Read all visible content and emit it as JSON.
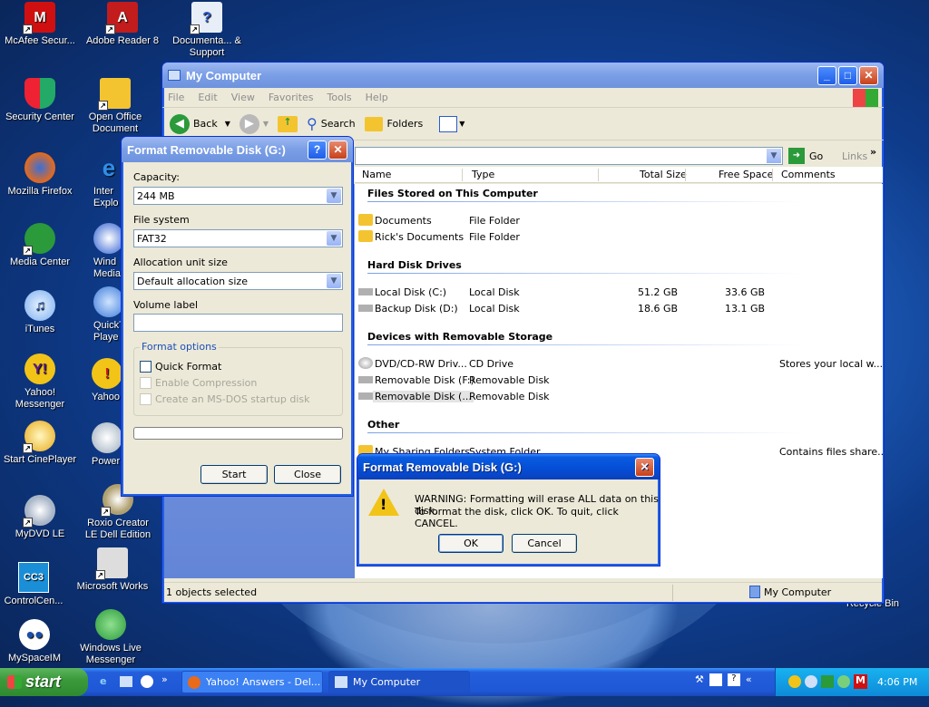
{
  "desktop_icons": [
    {
      "label": "McAfee Secur...",
      "icon": "mcafee-icon"
    },
    {
      "label": "Adobe Reader 8",
      "icon": "adobe-reader-icon"
    },
    {
      "label": "Documenta... & Support",
      "icon": "help-document-icon"
    },
    {
      "label": "Security Center",
      "icon": "shield-icon"
    },
    {
      "label": "Open Office Document",
      "icon": "open-office-icon"
    },
    {
      "label": "Mozilla Firefox",
      "icon": "firefox-icon"
    },
    {
      "label": "Inter Explo",
      "icon": "internet-explorer-icon"
    },
    {
      "label": "Media Center",
      "icon": "media-center-icon"
    },
    {
      "label": "Wind Media",
      "icon": "media-player-icon"
    },
    {
      "label": "iTunes",
      "icon": "itunes-icon"
    },
    {
      "label": "QuickT Playe",
      "icon": "quicktime-icon"
    },
    {
      "label": "Yahoo! Messenger",
      "icon": "yahoo-messenger-icon"
    },
    {
      "label": "Yahoo",
      "icon": "yahoo-icon"
    },
    {
      "label": "Start CinePlayer",
      "icon": "cineplayer-icon"
    },
    {
      "label": "PowerD",
      "icon": "powerdvd-icon"
    },
    {
      "label": "MyDVD LE",
      "icon": "mydvd-icon"
    },
    {
      "label": "Roxio Creator LE Dell Edition",
      "icon": "roxio-icon"
    },
    {
      "label": "ControlCen...",
      "icon": "controlcenter-icon"
    },
    {
      "label": "Microsoft Works",
      "icon": "works-icon"
    },
    {
      "label": "MySpaceIM",
      "icon": "myspace-icon"
    },
    {
      "label": "Windows Live Messenger",
      "icon": "live-messenger-icon"
    },
    {
      "label": "Recycle Bin",
      "icon": "recycle-bin-icon"
    }
  ],
  "mycomputer": {
    "title": "My Computer",
    "menu": [
      "File",
      "Edit",
      "View",
      "Favorites",
      "Tools",
      "Help"
    ],
    "toolbar": {
      "back": "Back",
      "search": "Search",
      "folders": "Folders"
    },
    "address": {
      "go": "Go",
      "links": "Links"
    },
    "columns": [
      "Name",
      "Type",
      "Total Size",
      "Free Space",
      "Comments"
    ],
    "groups": {
      "stored": "Files Stored on This Computer",
      "hdd": "Hard Disk Drives",
      "removable": "Devices with Removable Storage",
      "other": "Other"
    },
    "rows": [
      {
        "name": "Documents",
        "type": "File Folder",
        "total": "",
        "free": "",
        "comments": ""
      },
      {
        "name": "Rick's Documents",
        "type": "File Folder",
        "total": "",
        "free": "",
        "comments": ""
      },
      {
        "name": "Local Disk (C:)",
        "type": "Local Disk",
        "total": "51.2 GB",
        "free": "33.6 GB",
        "comments": ""
      },
      {
        "name": "Backup Disk (D:)",
        "type": "Local Disk",
        "total": "18.6 GB",
        "free": "13.1 GB",
        "comments": ""
      },
      {
        "name": "DVD/CD-RW Driv...",
        "type": "CD Drive",
        "total": "",
        "free": "",
        "comments": "Stores your local w..."
      },
      {
        "name": "Removable Disk (F:)",
        "type": "Removable Disk",
        "total": "",
        "free": "",
        "comments": ""
      },
      {
        "name": "Removable Disk (...",
        "type": "Removable Disk",
        "total": "",
        "free": "",
        "comments": ""
      },
      {
        "name": "My Sharing Folders",
        "type": "System Folder",
        "total": "",
        "free": "",
        "comments": "Contains files share..."
      }
    ],
    "status_left": "1 objects selected",
    "status_right": "My Computer"
  },
  "format_dialog": {
    "title": "Format Removable Disk (G:)",
    "capacity_label": "Capacity:",
    "capacity_value": "244 MB",
    "fs_label": "File system",
    "fs_value": "FAT32",
    "alloc_label": "Allocation unit size",
    "alloc_value": "Default allocation size",
    "volume_label": "Volume label",
    "volume_value": "",
    "options_label": "Format options",
    "quick_format": "Quick Format",
    "compression": "Enable Compression",
    "msdos": "Create an MS-DOS startup disk",
    "start": "Start",
    "close": "Close"
  },
  "warning_dialog": {
    "title": "Format Removable Disk (G:)",
    "line1": "WARNING: Formatting will erase ALL data on this disk.",
    "line2": "To format the disk, click OK. To quit, click CANCEL.",
    "ok": "OK",
    "cancel": "Cancel"
  },
  "taskbar": {
    "start": "start",
    "items": [
      "Yahoo! Answers - Del...",
      "My Computer"
    ],
    "clock": "4:06 PM"
  }
}
